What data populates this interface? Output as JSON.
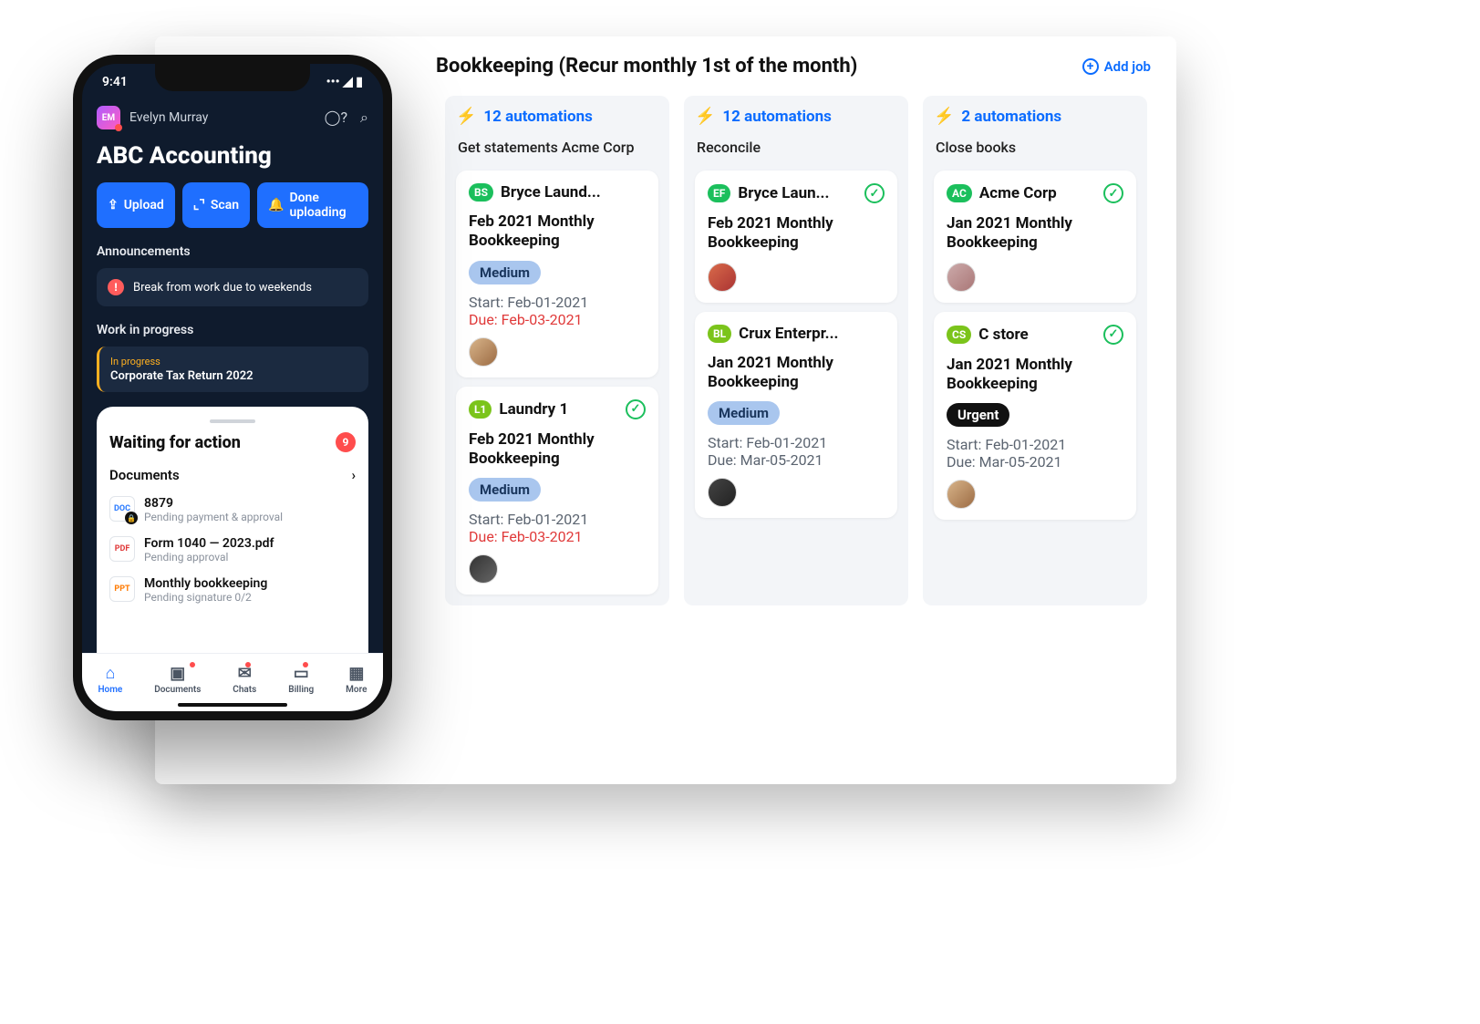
{
  "board": {
    "title": "Bookkeeping (Recur monthly 1st of the month)",
    "add_job_label": "Add job",
    "columns": [
      {
        "automations": "12 automations",
        "name": "Get statements Acme Corp",
        "cards": [
          {
            "initials": "BS",
            "initials_bg": "#1bbf5c",
            "client": "Bryce Laund...",
            "title": "Feb 2021 Monthly Bookkeeping",
            "priority": "Medium",
            "start": "Start: Feb-01-2021",
            "due": "Due: Feb-03-2021",
            "due_red": true,
            "check": false
          },
          {
            "initials": "L1",
            "initials_bg": "#7bc41b",
            "client": "Laundry 1",
            "title": "Feb 2021 Monthly Bookkeeping",
            "priority": "Medium",
            "start": "Start: Feb-01-2021",
            "due": "Due: Feb-03-2021",
            "due_red": true,
            "check": true
          }
        ]
      },
      {
        "automations": "12 automations",
        "name": "Reconcile",
        "cards": [
          {
            "initials": "EF",
            "initials_bg": "#1bbf5c",
            "client": "Bryce Laun...",
            "title": "Feb 2021 Monthly Bookkeeping",
            "check": true
          },
          {
            "initials": "BL",
            "initials_bg": "#7bc41b",
            "client": "Crux Enterpr...",
            "title": "Jan 2021 Monthly Bookkeeping",
            "priority": "Medium",
            "start": "Start: Feb-01-2021",
            "due": "Due: Mar-05-2021",
            "due_red": false,
            "check": false
          }
        ]
      },
      {
        "automations": "2 automations",
        "name": "Close books",
        "cards": [
          {
            "initials": "AC",
            "initials_bg": "#1bbf5c",
            "client": "Acme Corp",
            "title": "Jan 2021 Monthly Bookkeeping",
            "check": true
          },
          {
            "initials": "CS",
            "initials_bg": "#7bc41b",
            "client": "C store",
            "title": "Jan 2021 Monthly Bookkeeping",
            "priority": "Urgent",
            "start": "Start: Feb-01-2021",
            "due": "Due: Mar-05-2021",
            "due_red": false,
            "check": true
          }
        ]
      }
    ]
  },
  "phone": {
    "time": "9:41",
    "user_initials": "EM",
    "user_name": "Evelyn Murray",
    "app_title": "ABC Accounting",
    "buttons": {
      "upload": "Upload",
      "scan": "Scan",
      "done": "Done uploading"
    },
    "announcements_label": "Announcements",
    "announcement": "Break from work due to weekends",
    "wip_label": "Work in progress",
    "wip_status": "In progress",
    "wip_title": "Corporate Tax Return 2022",
    "waiting_label": "Waiting for action",
    "waiting_count": "9",
    "documents_label": "Documents",
    "docs": [
      {
        "icon": "DOC",
        "name": "8879",
        "sub": "Pending payment & approval",
        "locked": true
      },
      {
        "icon": "PDF",
        "name": "Form 1040 — 2023.pdf",
        "sub": "Pending approval",
        "locked": false
      },
      {
        "icon": "PPT",
        "name": "Monthly bookkeeping",
        "sub": "Pending signature 0/2",
        "locked": false
      }
    ],
    "tabs": [
      "Home",
      "Documents",
      "Chats",
      "Billing",
      "More"
    ]
  }
}
